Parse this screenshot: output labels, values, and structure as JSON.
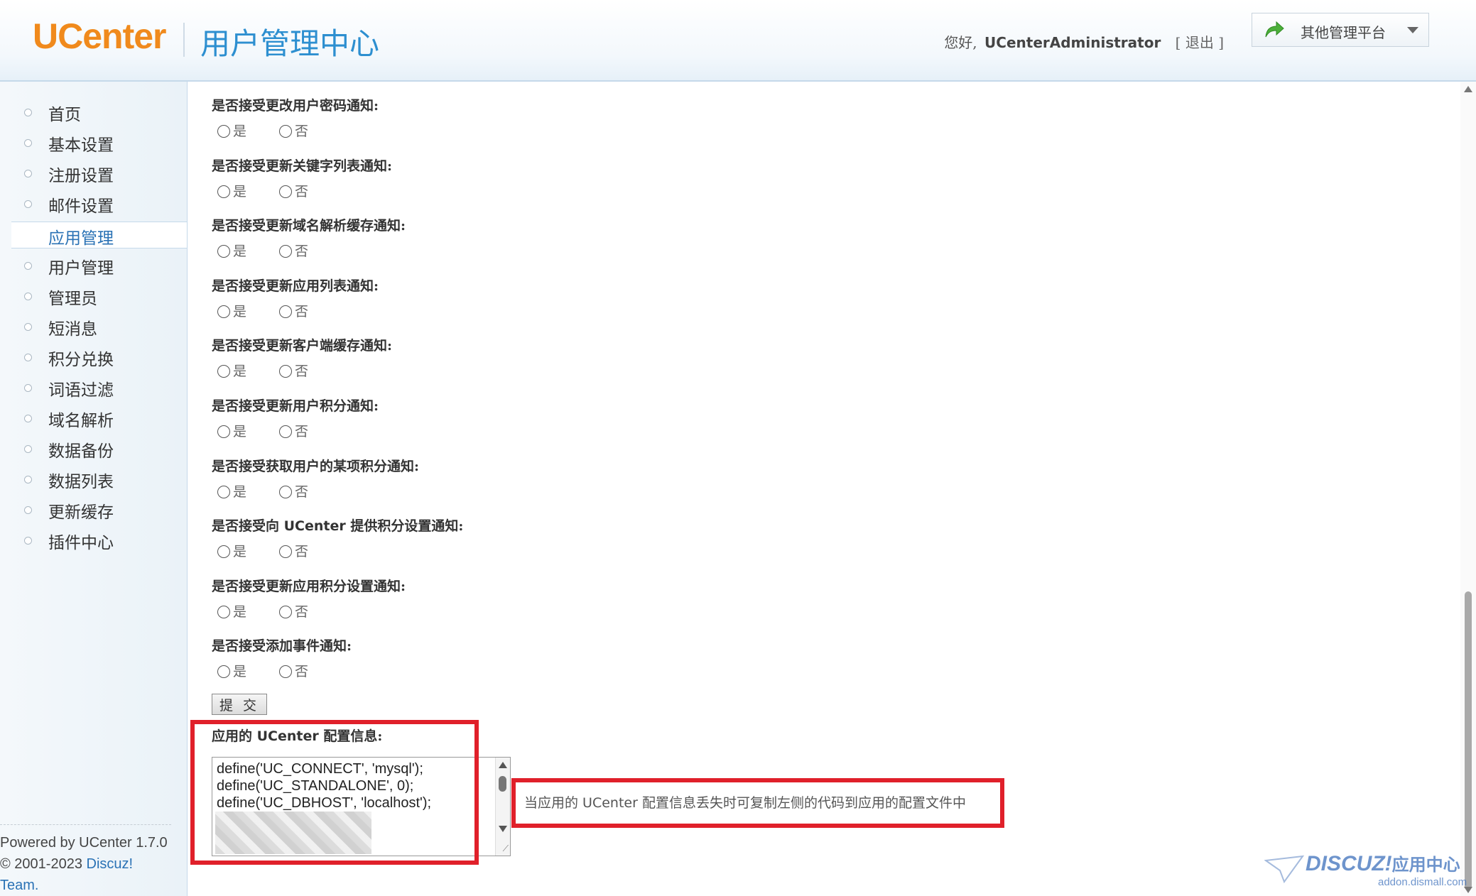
{
  "header": {
    "logo": "UCenter",
    "title_cn": "用户管理中心",
    "greeting": "您好,",
    "username": "UCenterAdministrator",
    "logout": "[ 退出 ]",
    "platform_label": "其他管理平台"
  },
  "sidebar": {
    "items": [
      {
        "label": "首页"
      },
      {
        "label": "基本设置"
      },
      {
        "label": "注册设置"
      },
      {
        "label": "邮件设置"
      },
      {
        "label": "应用管理"
      },
      {
        "label": "用户管理"
      },
      {
        "label": "管理员"
      },
      {
        "label": "短消息"
      },
      {
        "label": "积分兑换"
      },
      {
        "label": "词语过滤"
      },
      {
        "label": "域名解析"
      },
      {
        "label": "数据备份"
      },
      {
        "label": "数据列表"
      },
      {
        "label": "更新缓存"
      },
      {
        "label": "插件中心"
      }
    ],
    "active_index": 4,
    "footer": {
      "powered": "Powered by UCenter 1.7.0",
      "copyright_prefix": "© 2001-2023 ",
      "discuz": "Discuz!",
      "team": "Team."
    }
  },
  "form": {
    "option_yes": "是",
    "option_no": "否",
    "questions": [
      {
        "pre": "是否接受更改用户密码通知:",
        "bold": "",
        "post": ""
      },
      {
        "pre": "是否接受更新关键字列表通知:",
        "bold": "",
        "post": ""
      },
      {
        "pre": "是否接受更新域名解析缓存通知:",
        "bold": "",
        "post": ""
      },
      {
        "pre": "是否接受更新应用列表通知:",
        "bold": "",
        "post": ""
      },
      {
        "pre": "是否接受更新客户端缓存通知:",
        "bold": "",
        "post": ""
      },
      {
        "pre": "是否接受更新用户积分通知:",
        "bold": "",
        "post": ""
      },
      {
        "pre": "是否接受获取用户的某项积分通知:",
        "bold": "",
        "post": ""
      },
      {
        "pre": "是否接受向 ",
        "bold": "UCenter",
        "post": " 提供积分设置通知:"
      },
      {
        "pre": "是否接受更新应用积分设置通知:",
        "bold": "",
        "post": ""
      },
      {
        "pre": "是否接受添加事件通知:",
        "bold": "",
        "post": ""
      }
    ],
    "submit_label": "提 交"
  },
  "config": {
    "title_pre": "应用的 ",
    "title_bold": "UCenter",
    "title_post": " 配置信息:",
    "lines": [
      "define('UC_CONNECT', 'mysql');",
      "define('UC_STANDALONE', 0);",
      "define('UC_DBHOST', 'localhost');"
    ],
    "hint_pre": "当应用的 ",
    "hint_bold": "UCenter",
    "hint_post": " 配置信息丢失时可复制左侧的代码到应用的配置文件中"
  },
  "watermark": {
    "brand": "DISCUZ!",
    "brand_cn": "应用中心",
    "url": "addon.dismall.com"
  },
  "colors": {
    "accent": "#2d8fd0",
    "logo": "#f08a1c",
    "highlight_border": "#e0202a"
  }
}
